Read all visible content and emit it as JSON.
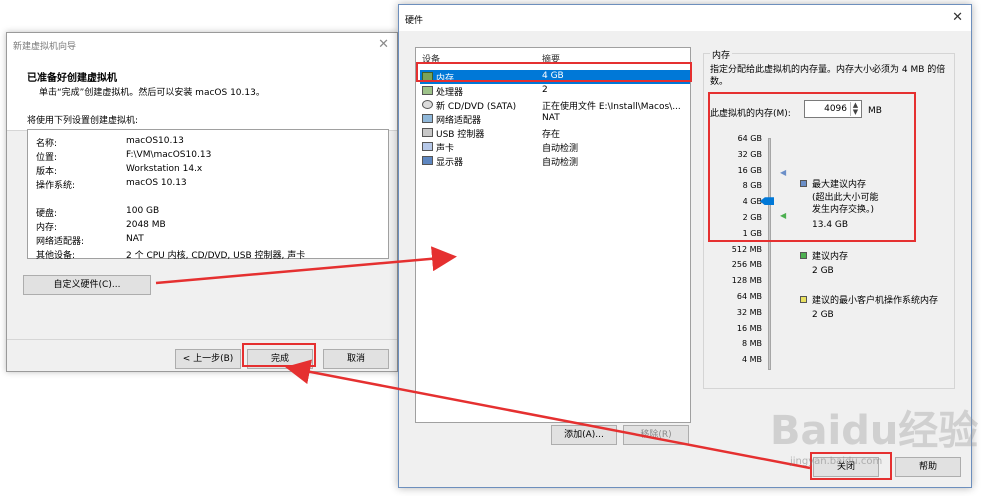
{
  "wizard": {
    "title": "新建虚拟机向导",
    "heading": "已准备好创建虚拟机",
    "subheading": "单击“完成”创建虚拟机。然后可以安装 macOS 10.13。",
    "intro": "将使用下列设置创建虚拟机:",
    "info": [
      {
        "label": "名称:",
        "value": "macOS10.13"
      },
      {
        "label": "位置:",
        "value": "F:\\VM\\macOS10.13"
      },
      {
        "label": "版本:",
        "value": "Workstation 14.x"
      },
      {
        "label": "操作系统:",
        "value": "macOS 10.13"
      },
      {
        "label": "硬盘:",
        "value": "100 GB"
      },
      {
        "label": "内存:",
        "value": "2048 MB"
      },
      {
        "label": "网络适配器:",
        "value": "NAT"
      },
      {
        "label": "其他设备:",
        "value": "2 个 CPU 内核, CD/DVD, USB 控制器, 声卡"
      }
    ],
    "customize_button": "自定义硬件(C)...",
    "back_button": "< 上一步(B)",
    "finish_button": "完成",
    "cancel_button": "取消"
  },
  "hardware": {
    "title": "硬件",
    "col_device": "设备",
    "col_summary": "摘要",
    "devices": [
      {
        "name": "内存",
        "summary": "4 GB",
        "icon": "memory-icon"
      },
      {
        "name": "处理器",
        "summary": "2",
        "icon": "cpu-icon"
      },
      {
        "name": "新 CD/DVD (SATA)",
        "summary": "正在使用文件 E:\\Install\\Macos\\...",
        "icon": "cd-icon"
      },
      {
        "name": "网络适配器",
        "summary": "NAT",
        "icon": "network-icon"
      },
      {
        "name": "USB 控制器",
        "summary": "存在",
        "icon": "usb-icon"
      },
      {
        "name": "声卡",
        "summary": "自动检测",
        "icon": "sound-icon"
      },
      {
        "name": "显示器",
        "summary": "自动检测",
        "icon": "display-icon"
      }
    ],
    "add_button": "添加(A)...",
    "remove_button": "移除(R)",
    "close_button": "关闭",
    "help_button": "帮助",
    "memory": {
      "group_title": "内存",
      "description": "指定分配给此虚拟机的内存量。内存大小必须为 4 MB 的倍数。",
      "field_label": "此虚拟机的内存(M):",
      "value": "4096",
      "unit": "MB",
      "scale": [
        "64 GB",
        "32 GB",
        "16 GB",
        "8 GB",
        "4 GB",
        "2 GB",
        "1 GB",
        "512 MB",
        "256 MB",
        "128 MB",
        "64 MB",
        "32 MB",
        "16 MB",
        "8 MB",
        "4 MB"
      ],
      "max_recommended_label": "最大建议内存",
      "max_recommended_note": "(超出此大小可能\n发生内存交换。)",
      "max_recommended_value": "13.4 GB",
      "recommended_label": "建议内存",
      "recommended_value": "2 GB",
      "min_guest_label": "建议的最小客户机操作系统内存",
      "min_guest_value": "2 GB",
      "colors": {
        "max": "#6b8fc8",
        "recommended": "#4caf50",
        "min_guest": "#e8e060"
      }
    }
  },
  "watermark": {
    "text": "Baidu经验",
    "url": "jingyan.baidu.com"
  }
}
